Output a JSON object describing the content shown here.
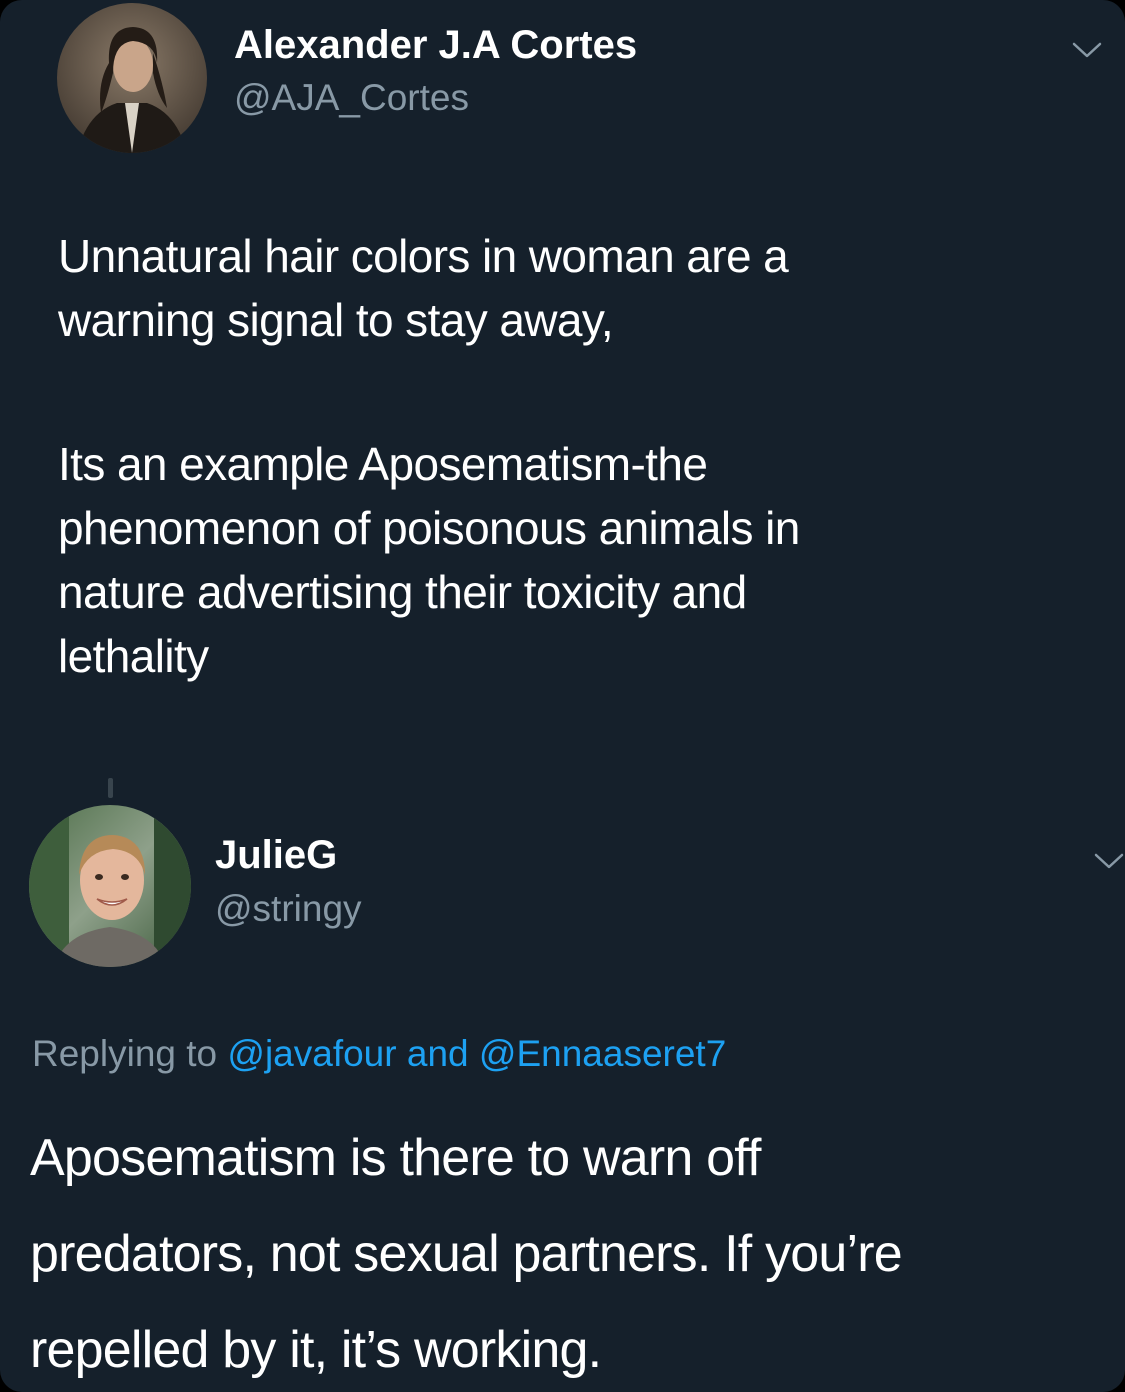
{
  "colors": {
    "background": "#15202b",
    "text_primary": "#ffffff",
    "text_secondary": "#8899a6",
    "link": "#1da1f2"
  },
  "tweets": [
    {
      "display_name": "Alexander J.A Cortes",
      "handle": "@AJA_Cortes",
      "menu_icon": "chevron-down-icon",
      "paragraphs": [
        "Unnatural hair colors in woman are a\nwarning signal to stay away,",
        "Its an example Aposematism-the\nphenomenon of poisonous animals in\nnature advertising their toxicity and\nlethality"
      ]
    },
    {
      "display_name": "JulieG",
      "handle": "@stringy",
      "menu_icon": "chevron-down-icon",
      "replying_prefix": "Replying to ",
      "replying_to": [
        "@javafour",
        "@Ennaaseret7"
      ],
      "replying_joiner": " and ",
      "text": "Aposematism is there to warn off\npredators, not sexual partners. If you’re\nrepelled by it, it’s working."
    }
  ]
}
